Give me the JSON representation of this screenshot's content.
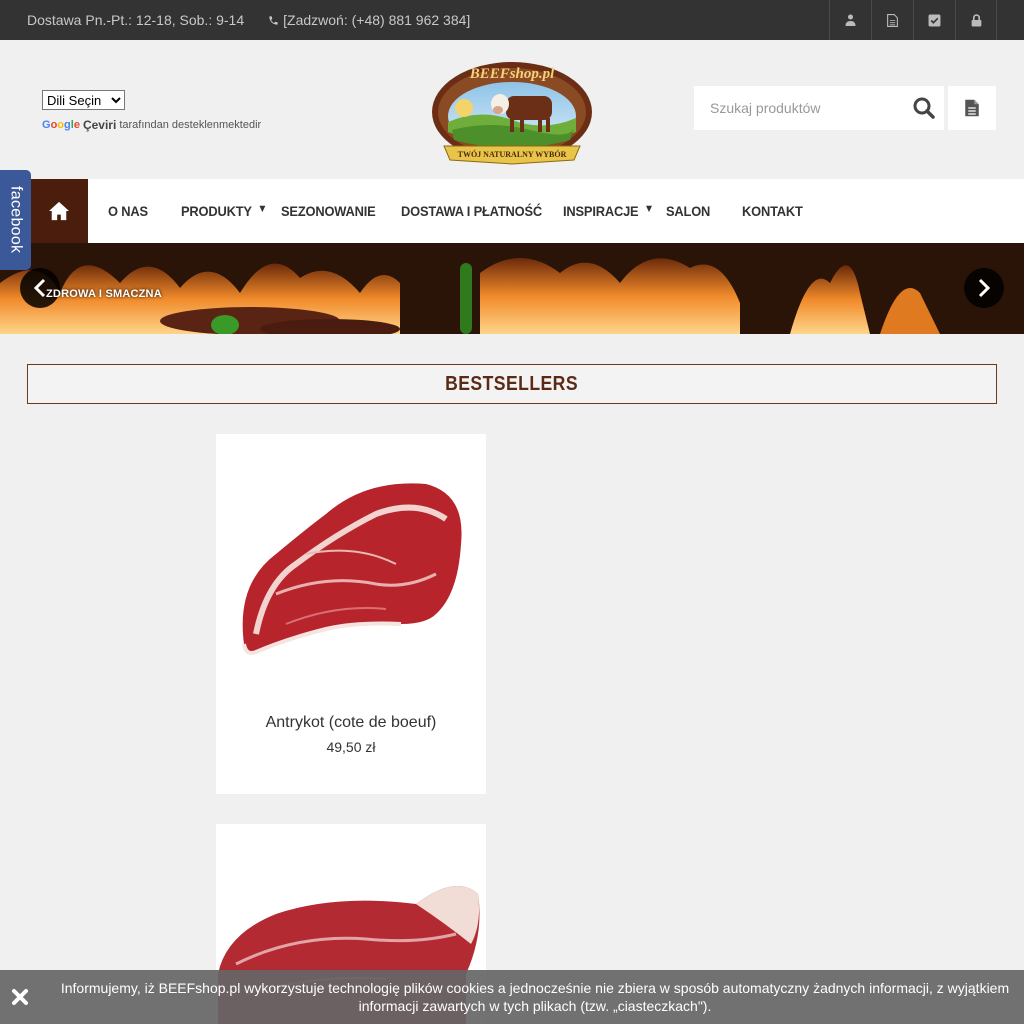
{
  "topbar": {
    "hours": "Dostawa Pn.-Pt.: 12-18, Sob.: 9-14",
    "phone": "[Zadzwoń: (+48) 881 962 384]",
    "icons": [
      "user-icon",
      "document-icon",
      "checkbox-icon",
      "lock-icon"
    ]
  },
  "translate": {
    "select_value": "Dili Seçin",
    "google_label": "Google",
    "ceviri": "Çeviri",
    "powered_by": "tarafından desteklenmektedir"
  },
  "logo": {
    "brand": "BEEFshop.pl",
    "slogan": "TWÓJ NATURALNY WYBÓR"
  },
  "search": {
    "placeholder": "Szukaj produktów"
  },
  "nav": {
    "items": [
      {
        "label": "O NAS"
      },
      {
        "label": "PRODUKTY"
      },
      {
        "label": "SEZONOWANIE"
      },
      {
        "label": "DOSTAWA I PŁATNOŚĆ"
      },
      {
        "label": "INSPIRACJE"
      },
      {
        "label": "SALON"
      },
      {
        "label": "KONTAKT"
      }
    ]
  },
  "facebook": {
    "label": "facebook",
    "color": "#3b5998"
  },
  "banner": {
    "caption": "ZDROWA I SMACZNA"
  },
  "bestsellers": {
    "heading": "BESTSELLERS",
    "products": [
      {
        "name": "Antrykot (cote de boeuf)",
        "price": "49,50 zł"
      },
      {
        "name": "",
        "price": ""
      }
    ]
  },
  "cookie": {
    "text": "Informujemy, iż BEEFshop.pl wykorzystuje technologię plików cookies a jednocześnie nie zbiera w sposób automatyczny żadnych informacji, z wyjątkiem informacji zawartych w tych plikach (tzw. „ciasteczkach\")."
  },
  "colors": {
    "topbar": "#333333",
    "accent_brown": "#4a1d0c",
    "heading_brown": "#5a2a16"
  }
}
